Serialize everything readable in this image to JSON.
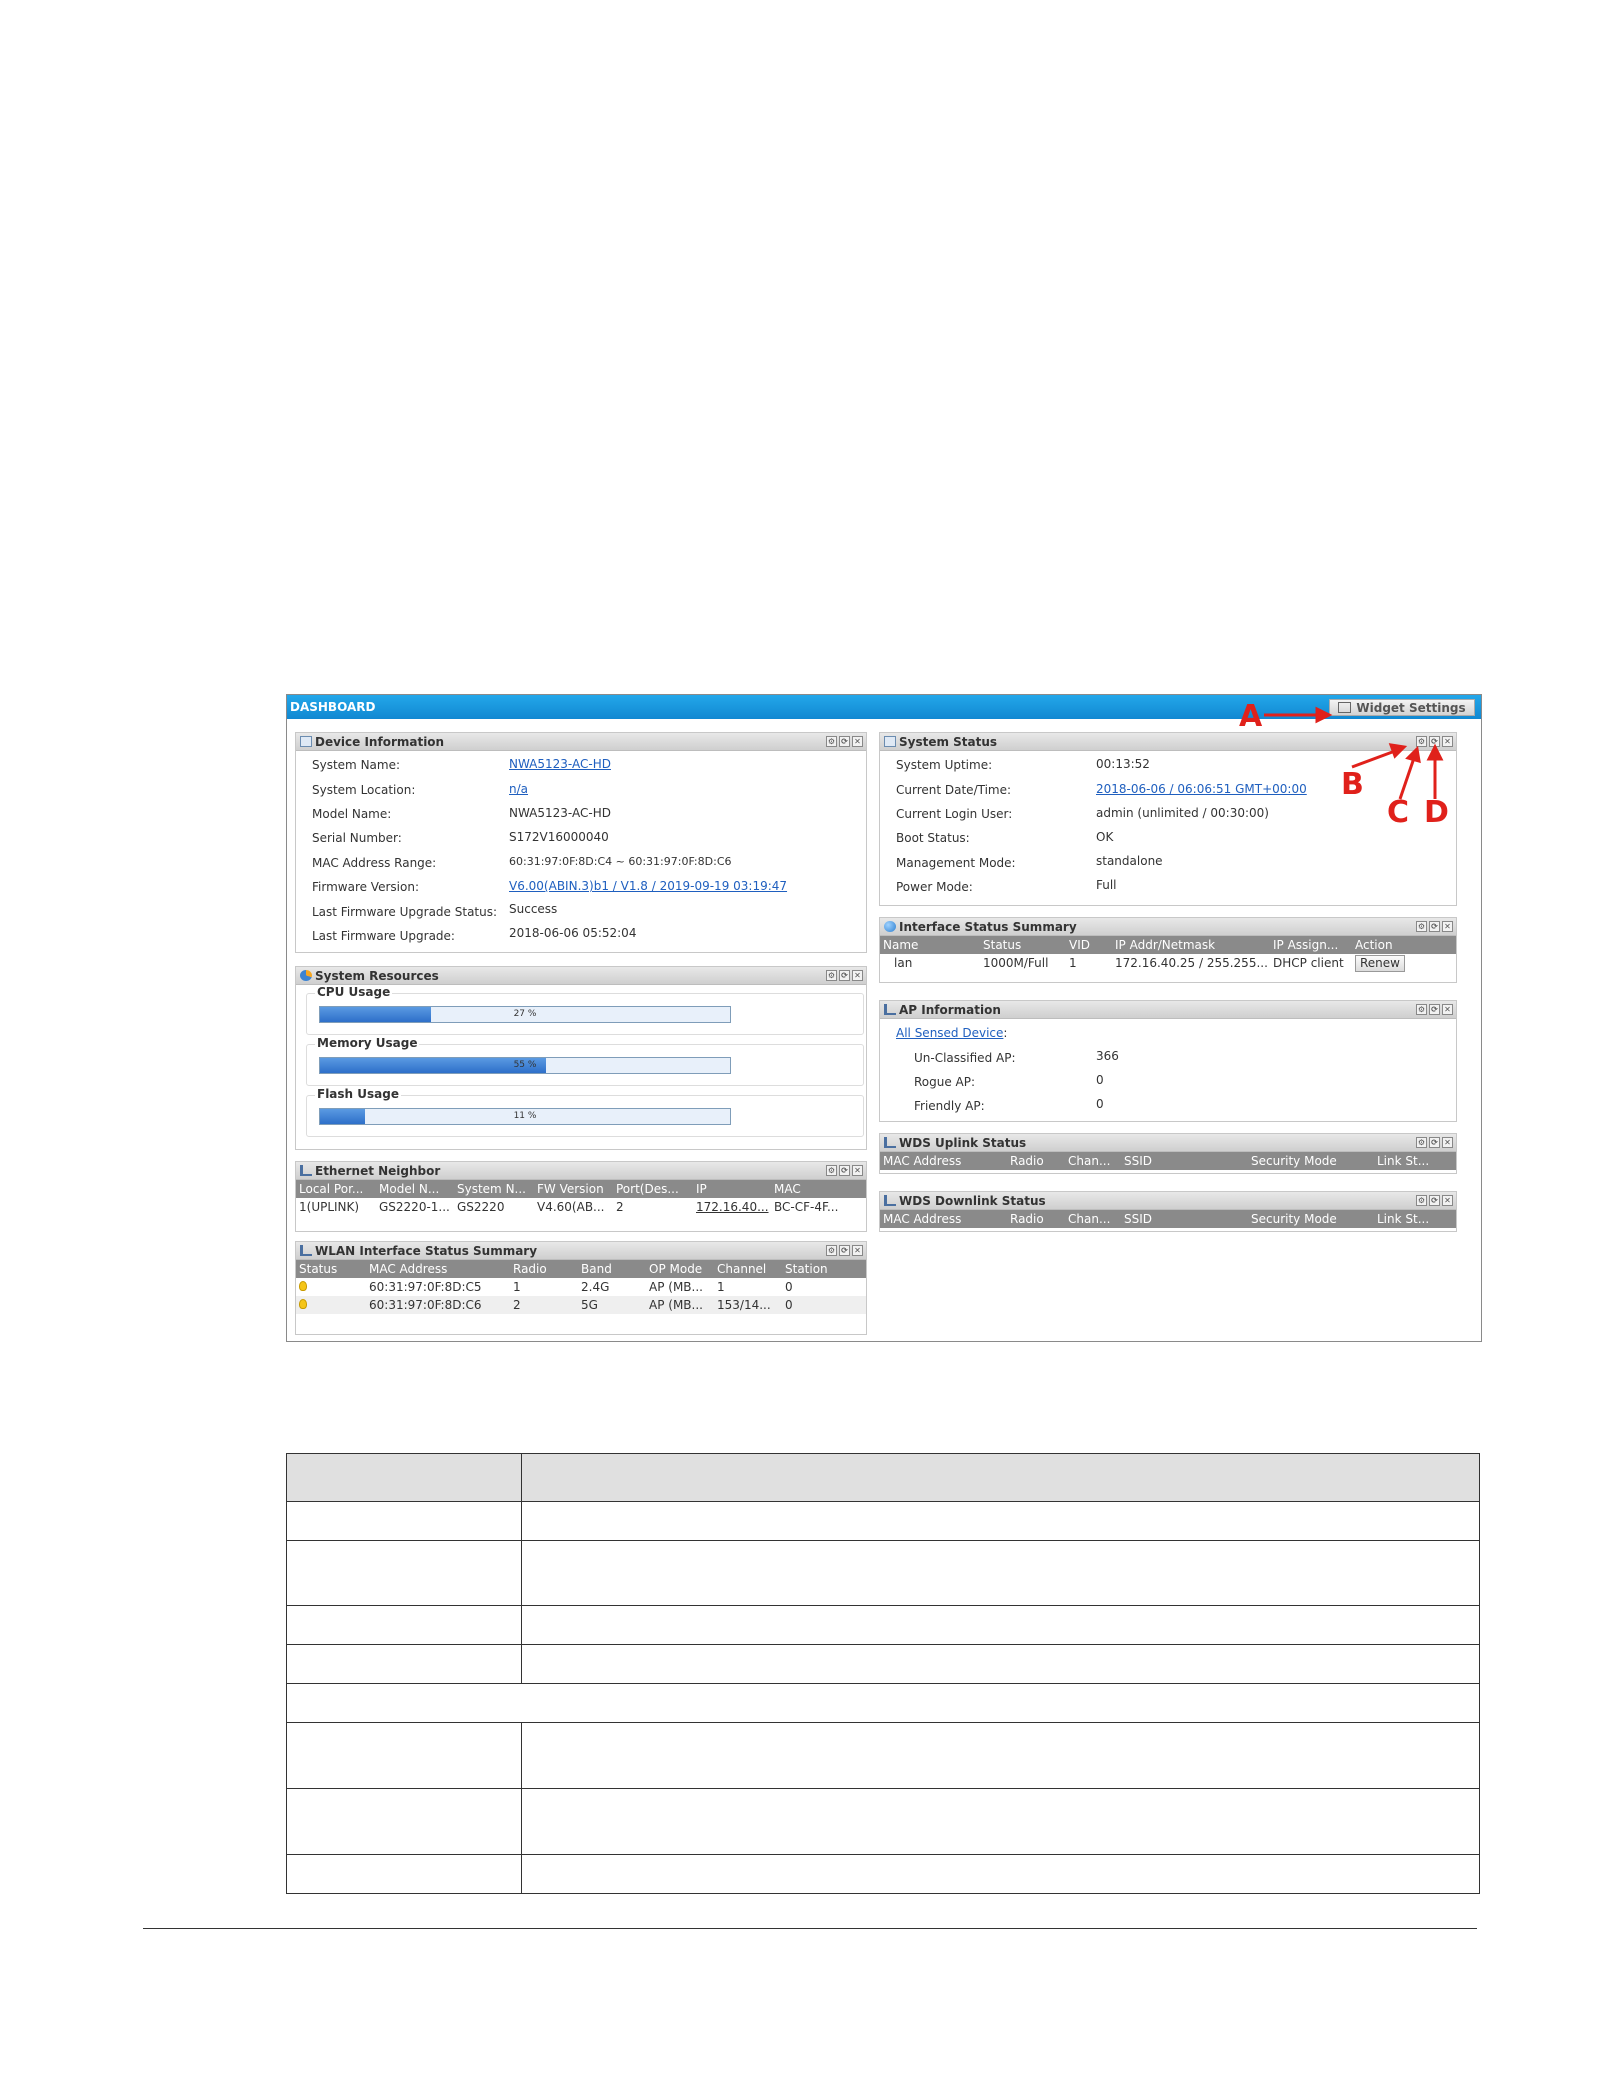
{
  "dashboard": {
    "title": "DASHBOARD",
    "widget_settings_label": "Widget Settings"
  },
  "annotations": {
    "a": "A",
    "b": "B",
    "c": "C",
    "d": "D"
  },
  "colors": {
    "header_blue": "#1a98de",
    "annotation_red": "#e0211b",
    "link_blue": "#1f5fbf",
    "table_header_gray": "#8a8a8a"
  },
  "device_information": {
    "title": "Device Information",
    "rows": [
      {
        "label": "System Name:",
        "value": "NWA5123-AC-HD"
      },
      {
        "label": "System Location:",
        "value": "n/a"
      },
      {
        "label": "Model Name:",
        "value": "NWA5123-AC-HD"
      },
      {
        "label": "Serial Number:",
        "value": "S172V16000040"
      },
      {
        "label": "MAC Address Range:",
        "value": "60:31:97:0F:8D:C4 ~ 60:31:97:0F:8D:C6"
      },
      {
        "label": "Firmware Version:",
        "value": "V6.00(ABIN.3)b1 / V1.8 / 2019-09-19 03:19:47"
      },
      {
        "label": "Last Firmware Upgrade Status:",
        "value": "Success"
      },
      {
        "label": "Last Firmware Upgrade:",
        "value": "2018-06-06 05:52:04"
      }
    ]
  },
  "system_resources": {
    "title": "System Resources",
    "items": [
      {
        "label": "CPU Usage",
        "percent_text": "27 %",
        "percent": 27
      },
      {
        "label": "Memory Usage",
        "percent_text": "55 %",
        "percent": 55
      },
      {
        "label": "Flash Usage",
        "percent_text": "11 %",
        "percent": 11
      }
    ]
  },
  "ethernet_neighbor": {
    "title": "Ethernet Neighbor",
    "columns": [
      "Local Por...",
      "Model N...",
      "System N...",
      "FW Version",
      "Port(Des...",
      "IP",
      "MAC"
    ],
    "rows": [
      [
        "1(UPLINK)",
        "GS2220-1...",
        "GS2220",
        "V4.60(AB...",
        "2",
        "172.16.40...",
        "BC-CF-4F..."
      ]
    ]
  },
  "wlan_summary": {
    "title": "WLAN Interface Status Summary",
    "columns": [
      "Status",
      "MAC Address",
      "Radio",
      "Band",
      "OP Mode",
      "Channel",
      "Station"
    ],
    "rows": [
      [
        "",
        "60:31:97:0F:8D:C5",
        "1",
        "2.4G",
        "AP (MB...",
        "1",
        "0"
      ],
      [
        "",
        "60:31:97:0F:8D:C6",
        "2",
        "5G",
        "AP (MB...",
        "153/14...",
        "0"
      ]
    ]
  },
  "system_status": {
    "title": "System Status",
    "rows": [
      {
        "label": "System Uptime:",
        "value": "00:13:52"
      },
      {
        "label": "Current Date/Time:",
        "value": "2018-06-06 / 06:06:51 GMT+00:00"
      },
      {
        "label": "Current Login User:",
        "value": "admin (unlimited / 00:30:00)"
      },
      {
        "label": "Boot Status:",
        "value": "OK"
      },
      {
        "label": "Management Mode:",
        "value": "standalone"
      },
      {
        "label": "Power Mode:",
        "value": "Full"
      }
    ]
  },
  "interface_summary": {
    "title": "Interface Status Summary",
    "columns": [
      "Name",
      "Status",
      "VID",
      "IP Addr/Netmask",
      "IP Assign...",
      "Action"
    ],
    "rows": [
      [
        "lan",
        "1000M/Full",
        "1",
        "172.16.40.25 / 255.255...",
        "DHCP client",
        "Renew"
      ]
    ]
  },
  "ap_information": {
    "title": "AP Information",
    "all_sensed_link": "All Sensed Device",
    "rows": [
      {
        "label": "Un-Classified AP:",
        "value": "366"
      },
      {
        "label": "Rogue AP:",
        "value": "0"
      },
      {
        "label": "Friendly AP:",
        "value": "0"
      }
    ]
  },
  "wds_uplink": {
    "title": "WDS Uplink Status",
    "columns": [
      "MAC Address",
      "Radio",
      "Chan...",
      "SSID",
      "Security Mode",
      "Link St..."
    ]
  },
  "wds_downlink": {
    "title": "WDS Downlink Status",
    "columns": [
      "MAC Address",
      "Radio",
      "Chan...",
      "SSID",
      "Security Mode",
      "Link St..."
    ]
  }
}
